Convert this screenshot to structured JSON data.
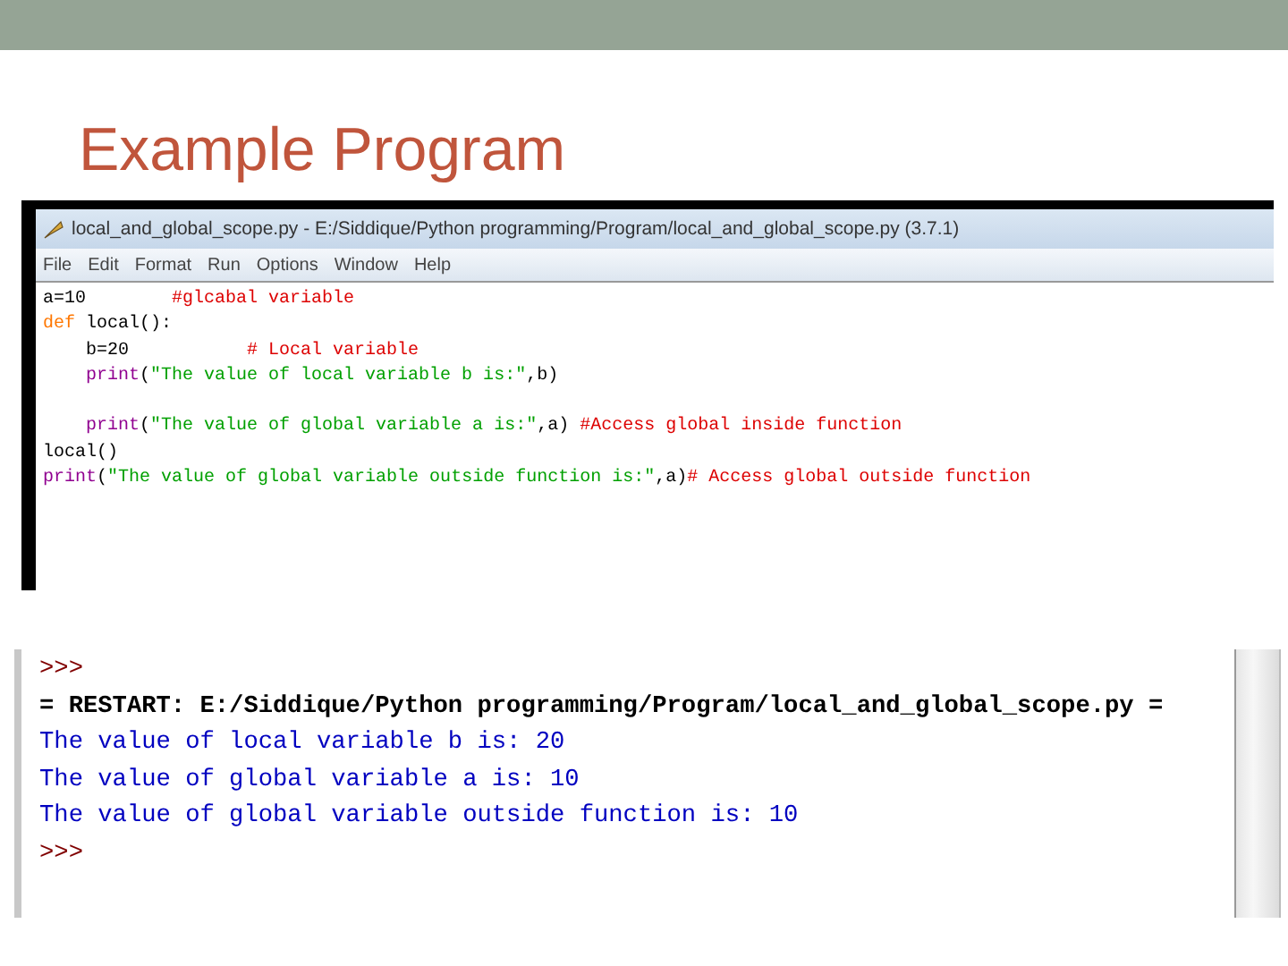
{
  "slide_title": "Example Program",
  "editor": {
    "title": "local_and_global_scope.py - E:/Siddique/Python programming/Program/local_and_global_scope.py (3.7.1)",
    "menu": [
      "File",
      "Edit",
      "Format",
      "Run",
      "Options",
      "Window",
      "Help"
    ],
    "lines": [
      [
        {
          "kind": "plain",
          "text": "a=10        "
        },
        {
          "kind": "comment",
          "text": "#glcabal variable"
        }
      ],
      [
        {
          "kind": "keyword",
          "text": "def "
        },
        {
          "kind": "plain",
          "text": "local():"
        }
      ],
      {
        "indented": true,
        "tokens": [
          {
            "kind": "plain",
            "text": "b=20           "
          },
          {
            "kind": "comment",
            "text": "# Local variable"
          }
        ]
      },
      {
        "indented": true,
        "tokens": [
          {
            "kind": "builtin",
            "text": "print"
          },
          {
            "kind": "plain",
            "text": "("
          },
          {
            "kind": "string",
            "text": "\"The value of local variable b is:\""
          },
          {
            "kind": "plain",
            "text": ",b)"
          }
        ]
      },
      {
        "indented": true,
        "gap_before": true,
        "tokens": [
          {
            "kind": "builtin",
            "text": "print"
          },
          {
            "kind": "plain",
            "text": "("
          },
          {
            "kind": "string",
            "text": "\"The value of global variable a is:\""
          },
          {
            "kind": "plain",
            "text": ",a) "
          },
          {
            "kind": "comment",
            "text": "#Access global inside function"
          }
        ]
      },
      [
        {
          "kind": "plain",
          "text": "local()"
        }
      ],
      [
        {
          "kind": "builtin",
          "text": "print"
        },
        {
          "kind": "plain",
          "text": "("
        },
        {
          "kind": "string",
          "text": "\"The value of global variable outside function is:\""
        },
        {
          "kind": "plain",
          "text": ",a)"
        },
        {
          "kind": "comment",
          "text": "# Access global outside function"
        }
      ]
    ]
  },
  "shell": {
    "lines": [
      {
        "kind": "prompt",
        "text": ">>>"
      },
      {
        "kind": "restart",
        "text": "= RESTART: E:/Siddique/Python programming/Program/local_and_global_scope.py ="
      },
      {
        "kind": "output",
        "text": "The value of local variable b is: 20"
      },
      {
        "kind": "output",
        "text": "The value of global variable a is: 10"
      },
      {
        "kind": "output",
        "text": "The value of global variable outside function is: 10"
      },
      {
        "kind": "prompt",
        "text": ">>>"
      }
    ]
  }
}
